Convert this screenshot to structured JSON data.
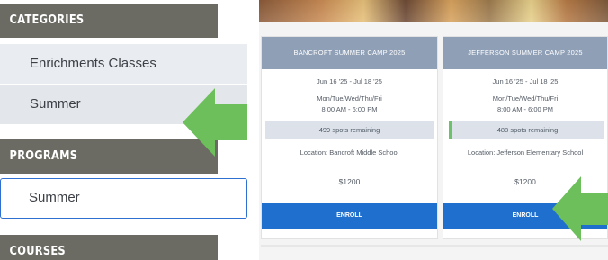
{
  "sidebar": {
    "categories_header": "CATEGORIES",
    "categories": [
      {
        "label": "Enrichments Classes"
      },
      {
        "label": "Summer"
      }
    ],
    "programs_header": "PROGRAMS",
    "programs": [
      {
        "label": "Summer"
      }
    ],
    "courses_header": "COURSES"
  },
  "cards": [
    {
      "title": "BANCROFT SUMMER CAMP 2025",
      "dates": "Jun 16 '25 - Jul 18 '25",
      "days": "Mon/Tue/Wed/Thu/Fri",
      "time": "8:00 AM - 6:00 PM",
      "spots": "499 spots remaining",
      "location": "Location: Bancroft Middle School",
      "price": "$1200",
      "enroll_label": "ENROLL"
    },
    {
      "title": "JEFFERSON SUMMER CAMP 2025",
      "dates": "Jun 16 '25 - Jul 18 '25",
      "days": "Mon/Tue/Wed/Thu/Fri",
      "time": "8:00 AM - 6:00 PM",
      "spots": "488 spots remaining",
      "location": "Location: Jefferson Elementary School",
      "price": "$1200",
      "enroll_label": "ENROLL"
    }
  ],
  "colors": {
    "header_bg": "#6b6b63",
    "card_title_bg": "#8f9fb6",
    "enroll_bg": "#1f6fce",
    "arrow": "#6cbf5a",
    "selected_border": "#2e6fd0"
  },
  "icons": {
    "arrow_sidebar": "left-arrow-icon",
    "arrow_enroll": "left-arrow-icon"
  }
}
